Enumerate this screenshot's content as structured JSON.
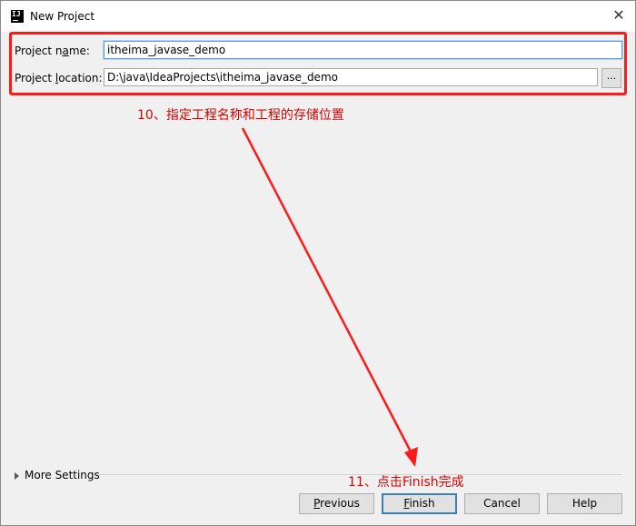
{
  "window": {
    "title": "New Project",
    "close_symbol": "✕"
  },
  "form": {
    "project_name": {
      "label_pre": "Project n",
      "label_mn": "a",
      "label_post": "me:",
      "value": "itheima_javase_demo"
    },
    "project_location": {
      "label_pre": "Project ",
      "label_mn": "l",
      "label_post": "ocation:",
      "value": "D:\\java\\IdeaProjects\\itheima_javase_demo",
      "browse_label": "..."
    }
  },
  "annotations": {
    "step10": "10、指定工程名称和工程的存储位置",
    "step11": "11、点击Finish完成",
    "color": "#e00000"
  },
  "more_settings": {
    "label": "More Settings"
  },
  "buttons": {
    "previous": {
      "mn": "P",
      "rest": "revious"
    },
    "finish": {
      "mn": "F",
      "rest": "inish"
    },
    "cancel": {
      "label": "Cancel"
    },
    "help": {
      "label": "Help"
    }
  },
  "icons": {
    "app": "intellij-idea-icon",
    "close": "close-icon",
    "expand": "triangle-right-icon"
  }
}
